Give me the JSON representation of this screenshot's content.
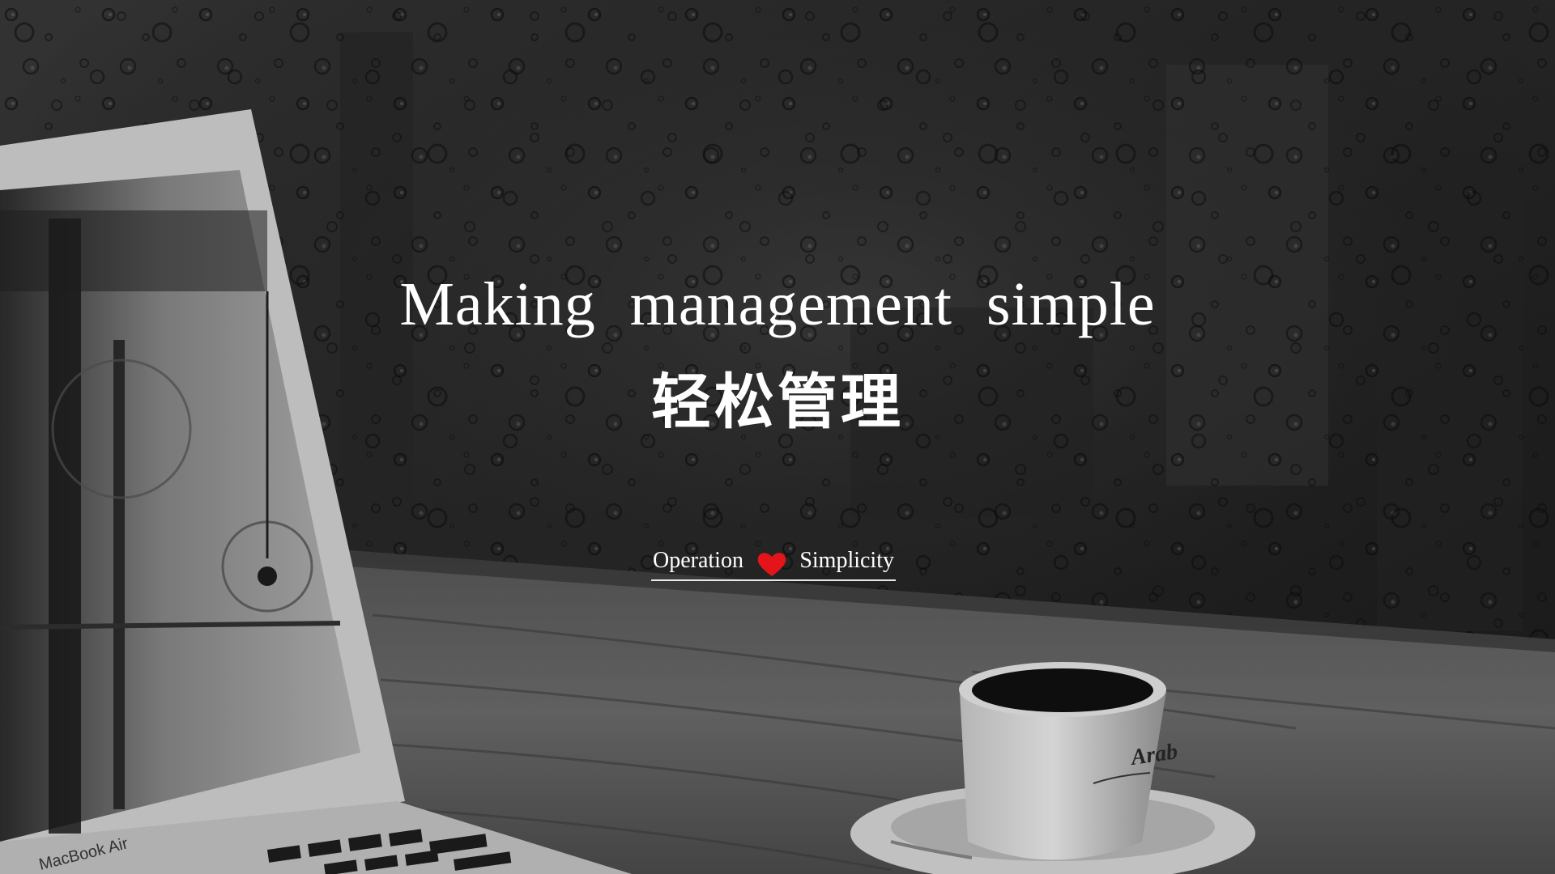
{
  "slide": {
    "headline": "Making  management  simple",
    "subtitle": "轻松管理",
    "tagline": {
      "left": "Operation",
      "right": "Simplicity",
      "separator_icon": "heart-icon"
    },
    "laptop_brand_label": "MacBook Air",
    "cup_label": "Arab"
  },
  "colors": {
    "heart": "#e3151a",
    "text": "#ffffff",
    "background": "#1f1f1f"
  }
}
